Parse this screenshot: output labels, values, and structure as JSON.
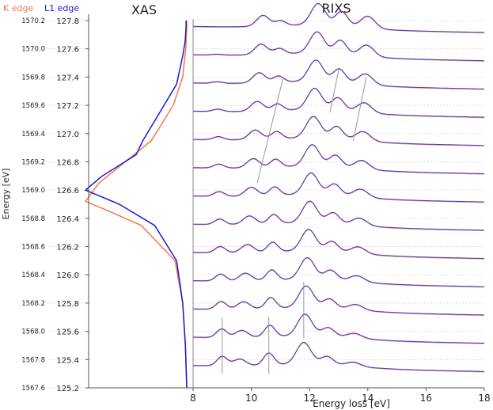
{
  "chart_data": {
    "type": "line",
    "panels": [
      {
        "title": "XAS",
        "series": [
          {
            "name": "K edge",
            "color": "#f07a4a",
            "x": [
              0,
              0.04,
              0.12,
              0.35,
              1.35,
              2.3,
              3.0,
              2.6,
              1.05,
              0.4,
              0.12,
              0.03,
              0.01,
              0,
              0
            ],
            "y": [
              1567.6,
              1567.9,
              1568.2,
              1568.5,
              1568.75,
              1568.85,
              1568.92,
              1569.05,
              1569.35,
              1569.6,
              1569.8,
              1570.0,
              1570.1,
              1570.15,
              1570.2
            ]
          },
          {
            "name": "L1 edge",
            "color": "#1a1ad6",
            "x": [
              0,
              0.04,
              0.12,
              0.3,
              0.95,
              2.0,
              3.0,
              2.5,
              1.5,
              1.3,
              0.8,
              0.3,
              0.12,
              0.05,
              0.02,
              0.02
            ],
            "y": [
              1567.6,
              1567.9,
              1568.2,
              1568.5,
              1568.75,
              1568.9,
              1569.0,
              1569.1,
              1569.25,
              1569.35,
              1569.55,
              1569.75,
              1569.95,
              1570.05,
              1570.15,
              1570.2
            ]
          }
        ],
        "yticks_left": [
          "1567.6",
          "1567.8",
          "1568.0",
          "1568.2",
          "1568.4",
          "1568.6",
          "1568.8",
          "1569.0",
          "1569.2",
          "1569.4",
          "1569.6",
          "1569.8",
          "1570.0",
          "1570.2"
        ],
        "yticks_right": [
          "125.2",
          "125.4",
          "125.6",
          "125.8",
          "126.0",
          "126.2",
          "126.4",
          "126.6",
          "126.8",
          "127.0",
          "127.2",
          "127.4",
          "127.6",
          "127.8"
        ],
        "ylabel": "Energy [eV]",
        "ylim": [
          1567.6,
          1570.2
        ]
      },
      {
        "title": "RIXS",
        "xlabel": "Energy loss [eV]",
        "xticks": [
          8,
          10,
          12,
          14,
          16,
          18
        ],
        "xlim": [
          8,
          18
        ],
        "series": [
          {
            "name": "K edge",
            "color": "#f07a4a"
          },
          {
            "name": "L1 edge",
            "color": "#1a1ad6"
          }
        ],
        "incident_energies": [
          1567.8,
          1568.0,
          1568.2,
          1568.4,
          1568.6,
          1568.8,
          1569.0,
          1569.2,
          1569.4,
          1569.6,
          1569.8,
          1570.0,
          1570.2
        ]
      }
    ],
    "legend": [
      "K edge",
      "L1 edge"
    ]
  }
}
